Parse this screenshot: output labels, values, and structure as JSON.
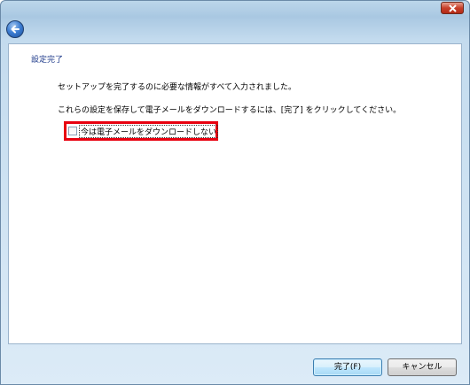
{
  "window": {
    "close_icon": "close-icon",
    "back_icon": "back-arrow-icon",
    "accent_color": "#c7402a"
  },
  "page": {
    "title": "設定完了",
    "message1": "セットアップを完了するのに必要な情報がすべて入力されました。",
    "message2": "これらの設定を保存して電子メールをダウンロードするには、[完了] をクリックしてください。",
    "checkbox": {
      "label": "今は電子メールをダウンロードしない",
      "checked": false
    },
    "highlight_color": "#e8000f"
  },
  "buttons": {
    "finish_label": "完了(F)",
    "cancel_label": "キャンセル"
  }
}
